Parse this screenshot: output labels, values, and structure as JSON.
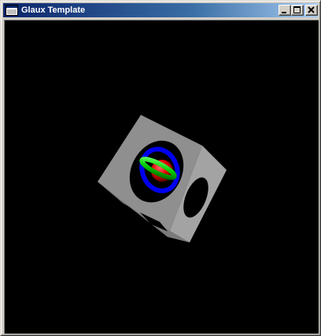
{
  "window": {
    "title": "Glaux Template",
    "icon": "window-app-icon",
    "controls": {
      "minimize_icon": "minimize-icon",
      "maximize_icon": "maximize-icon",
      "close_icon": "close-icon"
    }
  },
  "viewport": {
    "background": "#000000",
    "scene": {
      "cube_color": "#8f8f8f",
      "rings": [
        "#0000ff",
        "#00cc00",
        "#ff0000"
      ]
    }
  }
}
